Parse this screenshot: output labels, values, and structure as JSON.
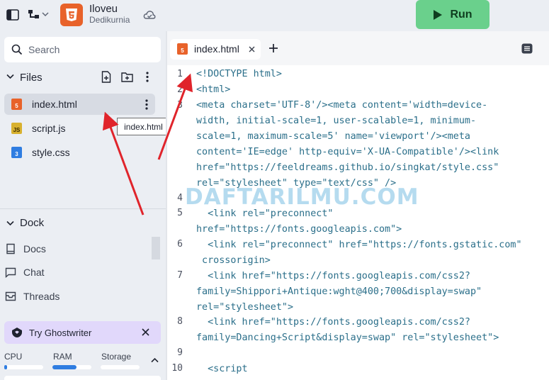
{
  "header": {
    "repl_name": "Iloveu",
    "owner": "Dedikurnia",
    "run_label": "Run",
    "icons": [
      "sidebar-toggle-icon",
      "project-tree-icon",
      "chevron-down-icon",
      "html5-icon",
      "cloud-sync-icon",
      "play-icon"
    ]
  },
  "sidebar": {
    "search_placeholder": "Search",
    "files_label": "Files",
    "files": [
      {
        "name": "index.html",
        "type": "html",
        "active": true
      },
      {
        "name": "script.js",
        "type": "js",
        "active": false
      },
      {
        "name": "style.css",
        "type": "css",
        "active": false
      }
    ],
    "tooltip": "index.html",
    "dock_label": "Dock",
    "dock_items": [
      "Docs",
      "Chat",
      "Threads"
    ],
    "ghostwriter_label": "Try Ghostwriter",
    "resources": {
      "cpu_label": "CPU",
      "ram_label": "RAM",
      "storage_label": "Storage",
      "cpu_fraction": 0.08,
      "ram_fraction": 0.62,
      "storage_fraction": 0.0
    }
  },
  "editor": {
    "tab_label": "index.html",
    "line_numbers": [
      "1",
      "2",
      "3",
      "4",
      "5",
      "6",
      "7",
      "8",
      "9",
      "10"
    ],
    "code_lines": [
      "<!DOCTYPE html>",
      "<html>",
      "<meta charset='UTF-8'/><meta content='width=device-",
      "width, initial-scale=1, user-scalable=1, minimum-",
      "scale=1, maximum-scale=5' name='viewport'/><meta",
      "content='IE=edge' http-equiv='X-UA-Compatible'/><link",
      "href=\"https://feeldreams.github.io/singkat/style.css\"",
      "rel=\"stylesheet\" type=\"text/css\" />",
      "",
      "  <link rel=\"preconnect\"",
      "href=\"https://fonts.googleapis.com\">",
      "  <link rel=\"preconnect\" href=\"https://fonts.gstatic.com\"",
      " crossorigin>",
      "  <link href=\"https://fonts.googleapis.com/css2?",
      "family=Shippori+Antique:wght@400;700&display=swap\"",
      "rel=\"stylesheet\">",
      "  <link href=\"https://fonts.googleapis.com/css2?",
      "family=Dancing+Script&display=swap\" rel=\"stylesheet\">",
      "",
      "  <script"
    ]
  },
  "watermark": "DAFTARILMU.COM",
  "colors": {
    "run_button": "#6ad08c",
    "annotation_arrow": "#e0242b",
    "html_icon": "#e8622a",
    "js_icon": "#d8b12f",
    "css_icon": "#2f7de1",
    "ghostwriter_bg": "#e1d8fb"
  }
}
